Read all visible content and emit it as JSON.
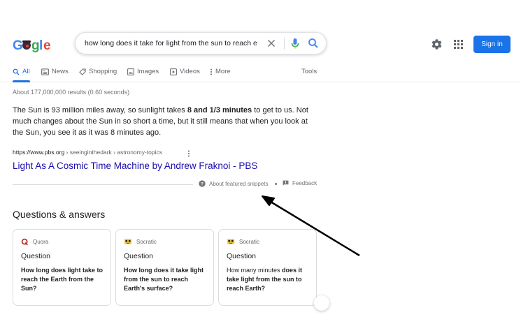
{
  "logo": {
    "text": "Google"
  },
  "search": {
    "query": "how long does it take for light from the sun to reach e"
  },
  "header": {
    "signin_label": "Sign in"
  },
  "tabs": [
    {
      "label": "All",
      "icon": "search-icon"
    },
    {
      "label": "News",
      "icon": "news-icon"
    },
    {
      "label": "Shopping",
      "icon": "tag-icon"
    },
    {
      "label": "Images",
      "icon": "image-icon"
    },
    {
      "label": "Videos",
      "icon": "play-icon"
    },
    {
      "label": "More",
      "icon": "more-vert-icon"
    }
  ],
  "tools_label": "Tools",
  "result_stats": "About 177,000,000 results (0.60 seconds)",
  "featured_snippet": {
    "text_before": "The Sun is 93 million miles away, so sunlight takes ",
    "text_bold": "8 and 1/3 minutes",
    "text_after": " to get to us. Not much changes about the Sun in so short a time, but it still means that when you look at the Sun, you see it as it was 8 minutes ago.",
    "cite_domain": "https://www.pbs.org",
    "cite_path": " › seeinginthedark › astronomy-topics",
    "title": "Light As A Cosmic Time Machine by Andrew Fraknoi - PBS",
    "about_label": "About featured snippets",
    "feedback_label": "Feedback"
  },
  "qa": {
    "heading": "Questions & answers",
    "cards": [
      {
        "source": "Quora",
        "kind": "Question",
        "question": "How long does light take to reach the Earth from the Sun?"
      },
      {
        "source": "Socratic",
        "kind": "Question",
        "question": "How long does it take light from the sun to reach Earth's surface?"
      },
      {
        "source": "Socratic",
        "kind": "Question",
        "question_before": "How many minutes ",
        "question_bold": "does it take light from the sun to reach Earth?"
      }
    ]
  },
  "colors": {
    "accent": "#1a73e8",
    "link": "#1a0dab",
    "muted": "#70757a"
  }
}
